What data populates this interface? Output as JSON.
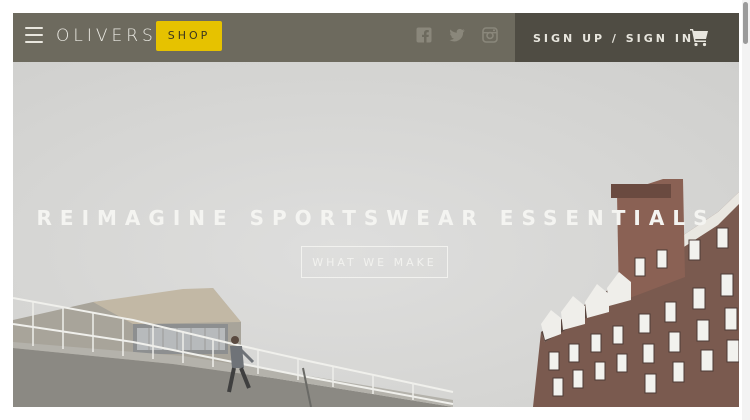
{
  "header": {
    "menu_icon": "hamburger-menu-icon",
    "brand": "OLIVERS",
    "shop_label": "SHOP",
    "social": [
      {
        "icon": "facebook-icon"
      },
      {
        "icon": "twitter-icon"
      },
      {
        "icon": "instagram-icon"
      }
    ],
    "auth_label": "SIGN UP / SIGN IN",
    "cart_icon": "shopping-cart-icon"
  },
  "hero": {
    "headline": "REIMAGINE SPORTSWEAR ESSENTIALS",
    "cta_label": "WHAT WE MAKE"
  },
  "colors": {
    "header_bg": "#6d6a5e",
    "auth_bg": "#4f4c43",
    "shop_accent": "#e6c200",
    "hero_text": "#f4f4f1"
  }
}
